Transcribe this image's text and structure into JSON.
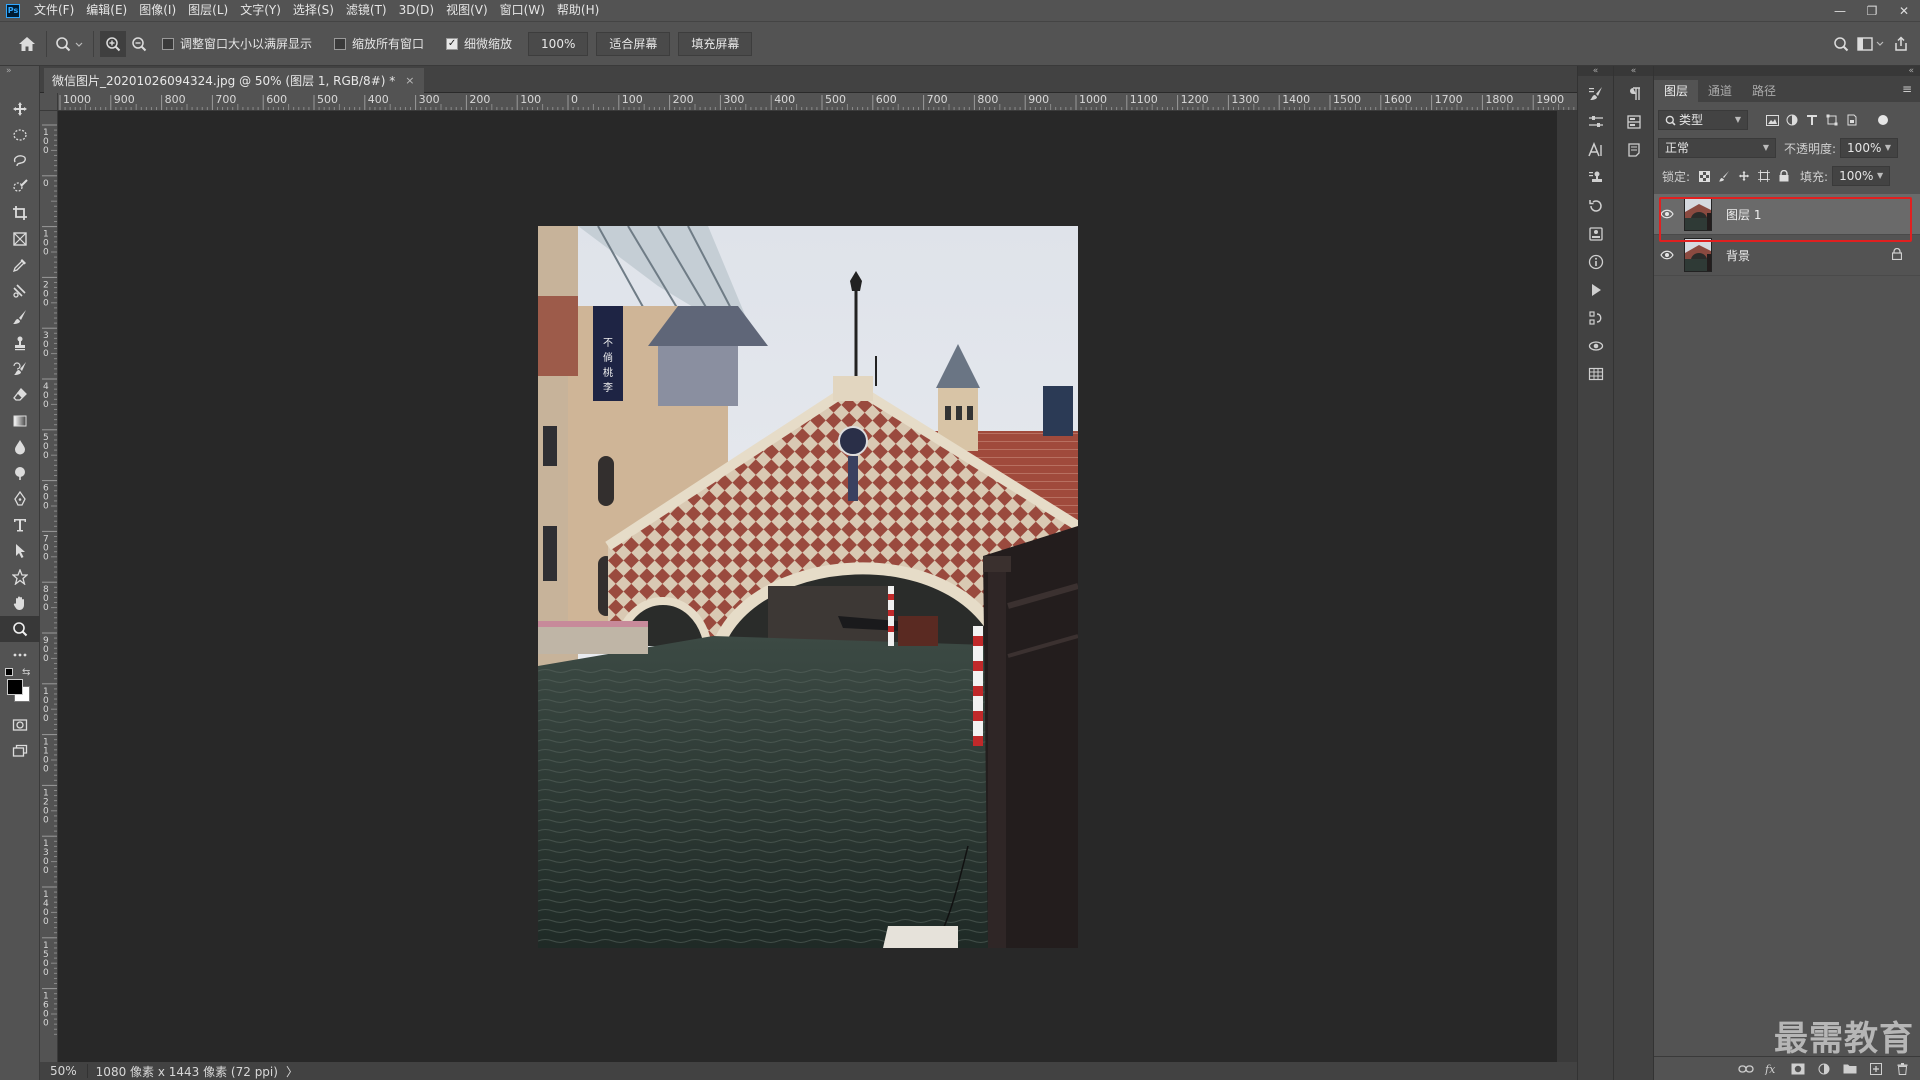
{
  "app": {
    "logo": "Ps",
    "menu": [
      "文件(F)",
      "编辑(E)",
      "图像(I)",
      "图层(L)",
      "文字(Y)",
      "选择(S)",
      "滤镜(T)",
      "3D(D)",
      "视图(V)",
      "窗口(W)",
      "帮助(H)"
    ],
    "window_controls": {
      "minimize": "—",
      "restore": "❐",
      "close": "✕"
    }
  },
  "options_bar": {
    "resize_windows_label": "调整窗口大小以满屏显示",
    "resize_windows_checked": false,
    "zoom_all_label": "缩放所有窗口",
    "zoom_all_checked": false,
    "scrubby_zoom_label": "细微缩放",
    "scrubby_zoom_checked": true,
    "zoom_100_label": "100%",
    "fit_screen_label": "适合屏幕",
    "fill_screen_label": "填充屏幕",
    "check_mark": "✓"
  },
  "document": {
    "tab_title": "微信图片_20201026094324.jpg @ 50% (图层 1, RGB/8#) *",
    "close": "×"
  },
  "rulers": {
    "top_labels": [
      "1000",
      "900",
      "800",
      "700",
      "600",
      "500",
      "400",
      "300",
      "200",
      "100",
      "0",
      "100",
      "200",
      "300",
      "400",
      "500",
      "600",
      "700",
      "800",
      "900",
      "1000",
      "1100",
      "1200",
      "1300",
      "1400",
      "1500",
      "1600",
      "1700",
      "1800",
      "1900",
      "200"
    ],
    "left_labels": [
      "100",
      "0",
      "100",
      "200",
      "300",
      "400",
      "500",
      "600",
      "700",
      "800",
      "900",
      "1000",
      "1100",
      "1200",
      "1300",
      "1400",
      "1500",
      "1600"
    ]
  },
  "status_bar": {
    "zoom": "50%",
    "info": "1080 像素 x 1443 像素 (72 ppi)",
    "arrow": "〉"
  },
  "layers_panel": {
    "collapse": "«",
    "tabs": [
      {
        "label": "图层",
        "active": true
      },
      {
        "label": "通道",
        "active": false
      },
      {
        "label": "路径",
        "active": false
      }
    ],
    "menu_icon": "≡",
    "filter_kind": "类型",
    "blend_mode": "正常",
    "opacity_label": "不透明度:",
    "opacity_value": "100%",
    "lock_label": "锁定:",
    "fill_label": "填充:",
    "fill_value": "100%",
    "layers": [
      {
        "name": "图层 1",
        "visible": true,
        "selected": true,
        "locked": false
      },
      {
        "name": "背景",
        "visible": true,
        "selected": false,
        "locked": true
      }
    ]
  },
  "dock": {
    "collapse_left": "«",
    "collapse_right": "«"
  },
  "watermark": "最需教育",
  "colors": {
    "panel_bg": "#535353",
    "canvas_bg": "#282828",
    "highlight_border": "#e02020",
    "selected_layer": "#6a6a6a"
  }
}
